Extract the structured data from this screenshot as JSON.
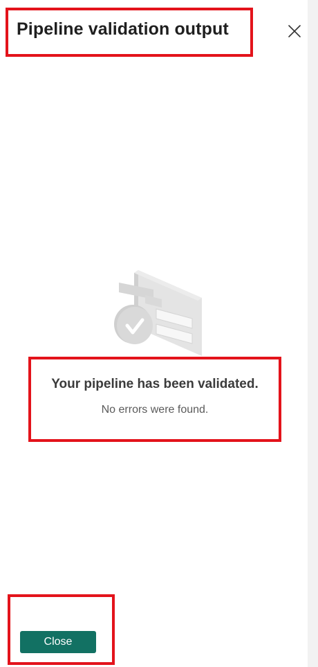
{
  "panel": {
    "title": "Pipeline validation output",
    "close_icon": "close-icon"
  },
  "result": {
    "illustration_icon": "validated-document-icon",
    "heading": "Your pipeline has been validated.",
    "subtext": "No errors were found."
  },
  "footer": {
    "close_label": "Close"
  },
  "colors": {
    "primary_button": "#127163",
    "highlight": "#e3131b",
    "title_text": "#1f1f1f"
  }
}
